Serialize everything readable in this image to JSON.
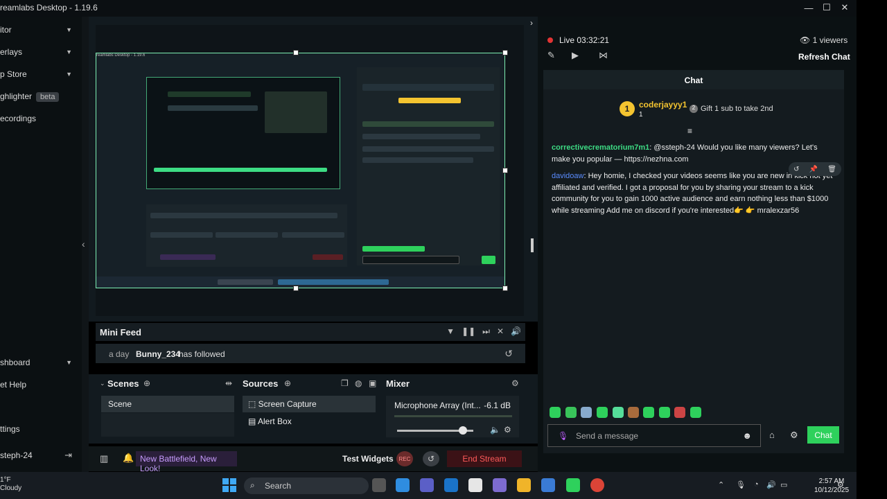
{
  "window": {
    "title": "reamlabs Desktop - 1.19.6",
    "minimize": "—",
    "maximize": "☐",
    "close": "✕"
  },
  "sidebar": {
    "items": [
      {
        "label": "itor",
        "chevron": "▼"
      },
      {
        "label": "erlays",
        "chevron": "▼"
      },
      {
        "label": "p Store",
        "chevron": "▼"
      },
      {
        "label": "ghlighter",
        "badge": "beta"
      },
      {
        "label": "ecordings"
      }
    ],
    "bottom": [
      {
        "label": "shboard",
        "chevron": "▼"
      },
      {
        "label": "et Help"
      },
      {
        "label": "ttings"
      },
      {
        "label": "steph-24",
        "icon": "logout-icon"
      }
    ],
    "collapse": "‹"
  },
  "preview": {
    "mini_title": "reamlabs Desktop - 1.19.6"
  },
  "mini_feed": {
    "title": "Mini Feed",
    "icons": [
      "filter-icon",
      "pause-icon",
      "skip-icon",
      "mute-alerts-icon",
      "volume-icon"
    ],
    "row": {
      "ago": "a day",
      "user": "Bunny_234",
      "action": "has followed"
    }
  },
  "scenes": {
    "title": "Scenes",
    "items": [
      "Scene"
    ]
  },
  "sources": {
    "title": "Sources",
    "items": [
      "Screen Capture",
      "Alert Box"
    ]
  },
  "mixer": {
    "title": "Mixer",
    "channel": "Microphone Array (Int...",
    "db": "-6.1 dB",
    "volume_fraction": 0.83
  },
  "statusbar": {
    "news": "New Battlefield, New Look!",
    "test_widgets": "Test Widgets",
    "rec": "REC",
    "end_stream": "End Stream"
  },
  "stream": {
    "live_label": "Live",
    "live_time": "03:32:21",
    "viewers": "1 viewers",
    "refresh_chat": "Refresh Chat"
  },
  "chat": {
    "title": "Chat",
    "top_sub": {
      "rank_badge": "1",
      "name": "coderjayyy1",
      "rank": "1",
      "gift_badge": "2",
      "gift": "Gift 1 sub to take 2nd"
    },
    "messages": [
      {
        "user": "correctivecrematorium7m1",
        "text": ": @ssteph-24 Would you like many viewers? Let's make you popular — https://nezhna.com"
      },
      {
        "user": "davidoaw",
        "text": ": Hey homie, I checked your videos seems like you are new in kick not yet affiliated and verified. I got a proposal for you by sharing your stream to a kick community for you to gain 1000 active audience and earn nothing less than $1000 while streaming Add me on discord if you're interested👉 👉 mralexzar56"
      }
    ],
    "placeholder": "Send a message",
    "send": "Chat"
  },
  "taskbar": {
    "weather_temp": "1°F",
    "weather_desc": "Cloudy",
    "search": "Search",
    "time": "2:57 AM",
    "date": "10/12/2025"
  },
  "colors": {
    "accent_green": "#2ed15c",
    "live_red": "#e23434",
    "end_stream_red": "#ff5a5a",
    "sub_gold": "#f4c430",
    "news_purple": "#c89cff"
  }
}
